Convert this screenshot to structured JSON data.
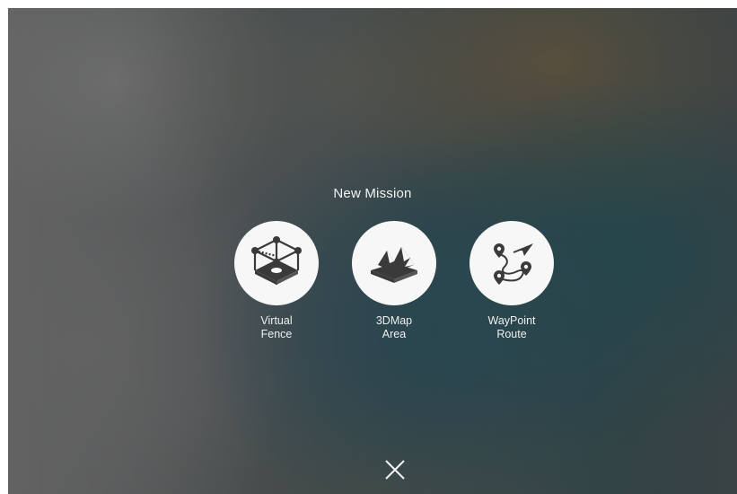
{
  "title": "New Mission",
  "options": [
    {
      "line1": "Virtual",
      "line2": "Fence",
      "icon": "virtual-fence-icon"
    },
    {
      "line1": "3DMap",
      "line2": "Area",
      "icon": "3dmap-area-icon"
    },
    {
      "line1": "WayPoint",
      "line2": "Route",
      "icon": "waypoint-route-icon"
    }
  ],
  "close_icon": "close-icon",
  "colors": {
    "circle": "#f7f7f7",
    "icon": "#3a3a3a",
    "text": "#eeeeee"
  }
}
